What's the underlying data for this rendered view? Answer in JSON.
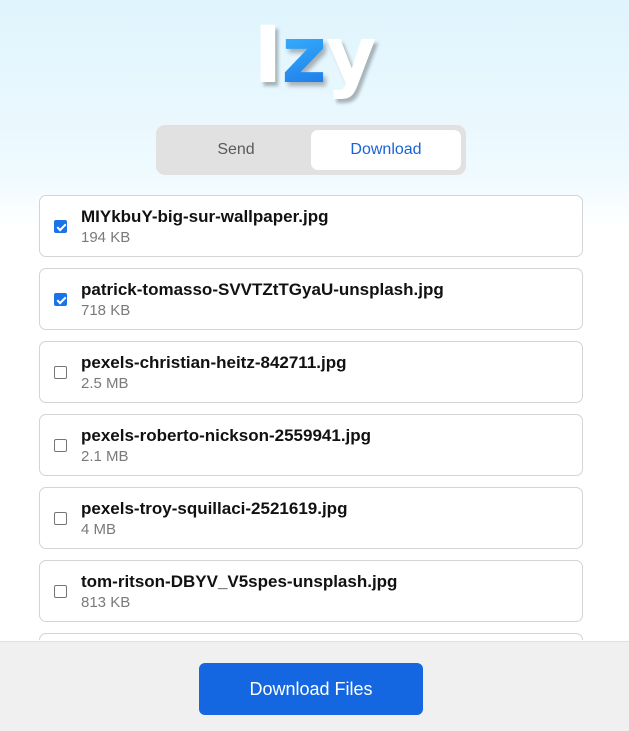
{
  "logo": {
    "part1": "I",
    "part2": "z",
    "part3": "y"
  },
  "tabs": [
    {
      "label": "Send",
      "active": false
    },
    {
      "label": "Download",
      "active": true
    }
  ],
  "files": [
    {
      "name": "MIYkbuY-big-sur-wallpaper.jpg",
      "size": "194 KB",
      "checked": true
    },
    {
      "name": "patrick-tomasso-SVVTZtTGyaU-unsplash.jpg",
      "size": "718 KB",
      "checked": true
    },
    {
      "name": "pexels-christian-heitz-842711.jpg",
      "size": "2.5 MB",
      "checked": false
    },
    {
      "name": "pexels-roberto-nickson-2559941.jpg",
      "size": "2.1 MB",
      "checked": false
    },
    {
      "name": "pexels-troy-squillaci-2521619.jpg",
      "size": "4 MB",
      "checked": false
    },
    {
      "name": "tom-ritson-DBYV_V5spes-unsplash.jpg",
      "size": "813 KB",
      "checked": false
    }
  ],
  "footer": {
    "download_label": "Download Files"
  },
  "colors": {
    "accent": "#1467e0",
    "tab_active_text": "#1a63d6",
    "checkbox": "#1a73e8"
  }
}
